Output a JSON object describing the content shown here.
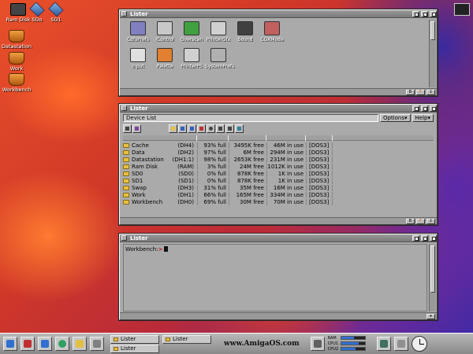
{
  "desktop": {
    "icons": [
      {
        "label": "Ram Disk",
        "icon": "ram-disk-icon"
      },
      {
        "label": "SDo",
        "icon": "disk-icon"
      },
      {
        "label": "SD1",
        "icon": "disk-icon"
      },
      {
        "label": "Datastation",
        "icon": "drawer-icon"
      },
      {
        "label": "Work",
        "icon": "drawer-icon"
      },
      {
        "label": "Workbench",
        "icon": "drawer-icon"
      }
    ]
  },
  "prefs_lister": {
    "title": "Lister",
    "items": [
      {
        "label": "CdfsPrefs",
        "color": "#8080c0"
      },
      {
        "label": "IControl",
        "color": "#c8c8c8"
      },
      {
        "label": "Overscan",
        "color": "#40a040"
      },
      {
        "label": "PrinterGfx",
        "color": "#d0d0d0"
      },
      {
        "label": "Sound",
        "color": "#404040"
      },
      {
        "label": "CGXMode",
        "color": "#c06060"
      },
      {
        "label": "Input",
        "color": "#e0e0e0"
      },
      {
        "label": "Palette",
        "color": "#e08030"
      },
      {
        "label": "PrinterPS",
        "color": "#d0d0d0"
      },
      {
        "label": "SystemPrefs",
        "color": "#b0b0b0"
      }
    ]
  },
  "device_lister": {
    "title": "Lister",
    "path": "Device List",
    "options_label": "Options▾",
    "help_label": "Help▾",
    "rows": [
      {
        "name": "Cache",
        "id": "(DH4)",
        "pct": "93% full",
        "free": "3495K free",
        "use": "46M in use",
        "dos": "[DOS3]"
      },
      {
        "name": "Data",
        "id": "(DH2)",
        "pct": "97% full",
        "free": "6M free",
        "use": "294M in use",
        "dos": "[DOS3]"
      },
      {
        "name": "Datastation",
        "id": "(DH1:1)",
        "pct": "98% full",
        "free": "2653K free",
        "use": "231M in use",
        "dos": "[DOS3]"
      },
      {
        "name": "Ram Disk",
        "id": "(RAM)",
        "pct": "3% full",
        "free": "24M free",
        "use": "1012K in use",
        "dos": "[DOS3]"
      },
      {
        "name": "SD0",
        "id": "(SD0)",
        "pct": "0% full",
        "free": "878K free",
        "use": "1K in use",
        "dos": "[DOS3]"
      },
      {
        "name": "SD1",
        "id": "(SD1)",
        "pct": "0% full",
        "free": "878K free",
        "use": "1K in use",
        "dos": "[DOS3]"
      },
      {
        "name": "Swap",
        "id": "(DH3)",
        "pct": "31% full",
        "free": "35M free",
        "use": "16M in use",
        "dos": "[DOS3]"
      },
      {
        "name": "Work",
        "id": "(DH1)",
        "pct": "66% full",
        "free": "165M free",
        "use": "334M in use",
        "dos": "[DOS3]"
      },
      {
        "name": "Workbench",
        "id": "(DH0)",
        "pct": "69% full",
        "free": "30M free",
        "use": "70M in use",
        "dos": "[DOS3]"
      }
    ]
  },
  "shell_lister": {
    "title": "Lister",
    "prompt": "Workbench:",
    "prompt_arrow": ">"
  },
  "taskbar": {
    "tasks": [
      "Lister",
      "Lister",
      "Lister"
    ],
    "brand": "www.AmigaOS.com",
    "meters": [
      {
        "label": "RAM",
        "level": 0.55,
        "color": "#3070d0"
      },
      {
        "label": "CPU1",
        "level": 0.75,
        "color": "#3070d0"
      },
      {
        "label": "CPU2",
        "level": 0.6,
        "color": "#3070d0"
      }
    ]
  }
}
